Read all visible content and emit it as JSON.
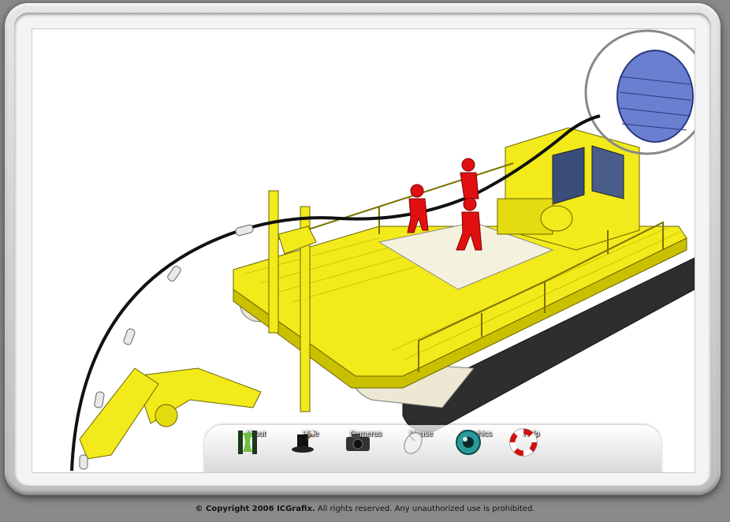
{
  "toolbar": {
    "items": [
      {
        "label": "About",
        "icon": "about-icon"
      },
      {
        "label": "Hide",
        "icon": "magic-hat-icon"
      },
      {
        "label": "Cameras",
        "icon": "camera-icon"
      },
      {
        "label": "Mouse",
        "icon": "mouse-icon"
      },
      {
        "label": "Graphics",
        "icon": "eye-icon"
      },
      {
        "label": "Help",
        "icon": "lifebuoy-icon"
      }
    ]
  },
  "footer": {
    "copyright_bold": "© Copyright 2006 ICGrafix.",
    "copyright_rest": " All rights reserved. Any unauthorized use is prohibited."
  },
  "colors": {
    "hull_yellow": "#f2ea1a",
    "crew_red": "#e01010",
    "reel_blue": "#6a7fd0",
    "pontoon_dark": "#2e2e2e"
  }
}
